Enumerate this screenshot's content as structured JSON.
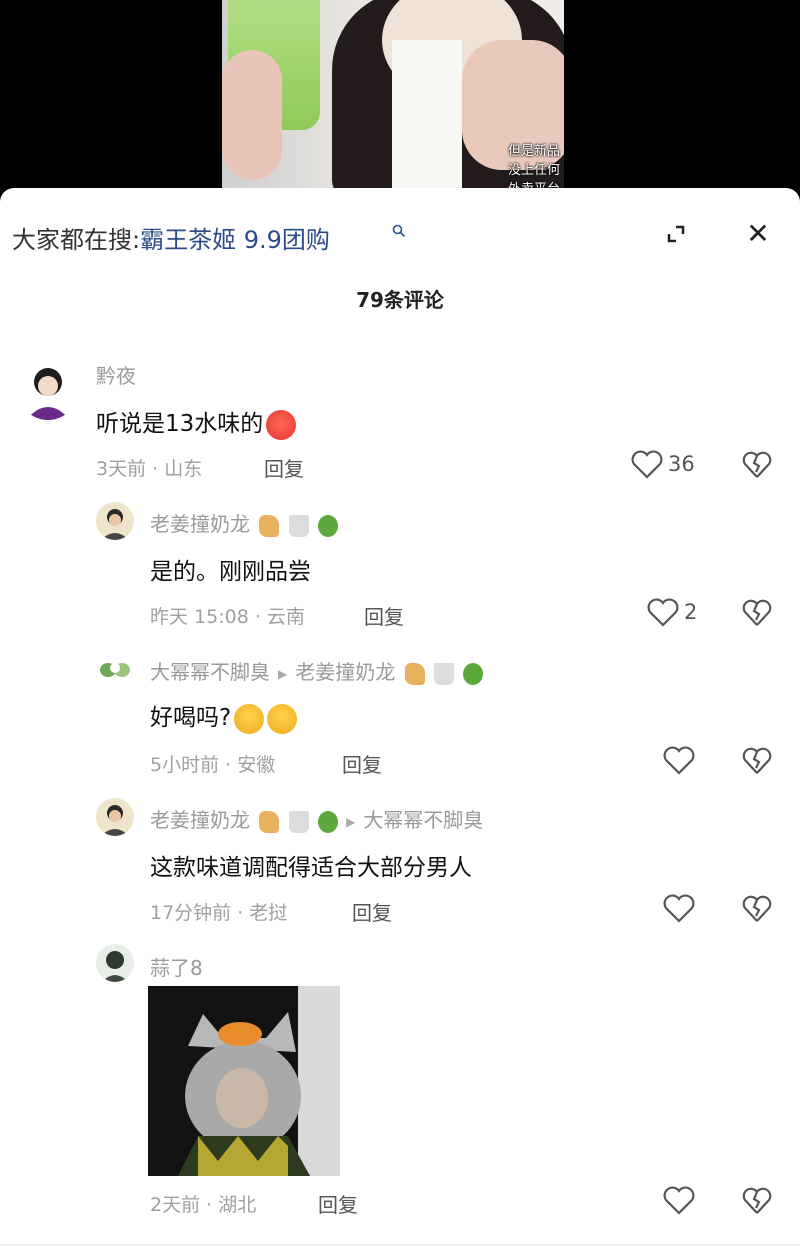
{
  "video": {
    "subtitle": "但是新品没上任何外卖平台"
  },
  "search": {
    "prefix": "大家都在搜:",
    "term": "霸王茶姬 9.9团购"
  },
  "comments_count": "79条评论",
  "comments": [
    {
      "user": "黔夜",
      "text": "听说是13水味的",
      "time": "3天前 · 山东",
      "reply": "回复",
      "likes": "36"
    },
    {
      "user": "老姜撞奶龙",
      "text": "是的。刚刚品尝",
      "time": "昨天 15:08 · 云南",
      "reply": "回复",
      "likes": "2"
    },
    {
      "user": "大幂幂不脚臭",
      "reply_to": "老姜撞奶龙",
      "text": "好喝吗?",
      "time": "5小时前 · 安徽",
      "reply": "回复"
    },
    {
      "user": "老姜撞奶龙",
      "reply_to": "大幂幂不脚臭",
      "text": "这款味道调配得适合大部分男人",
      "time": "17分钟前 · 老挝",
      "reply": "回复"
    },
    {
      "user": "蒜了8",
      "time": "2天前 · 湖北",
      "reply": "回复"
    }
  ],
  "colors": {
    "search_term": "#2b4b8a",
    "sheet": "#ffffff"
  }
}
